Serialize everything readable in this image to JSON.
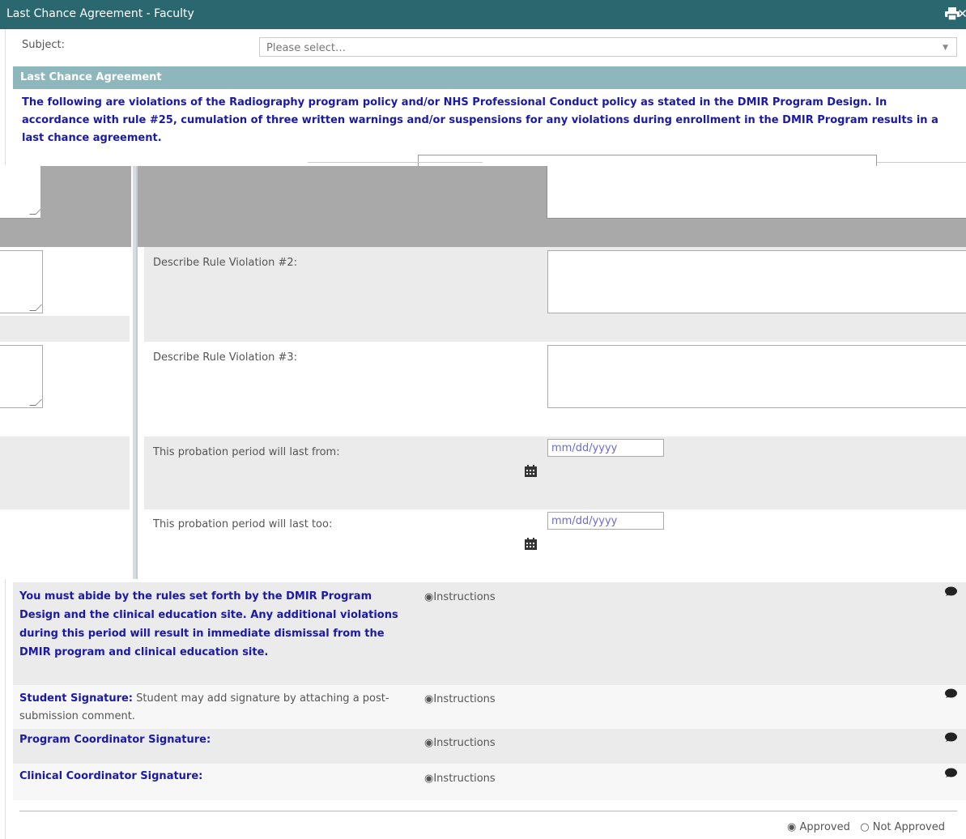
{
  "window": {
    "title": "Last Chance Agreement - Faculty"
  },
  "subject": {
    "label": "Subject:",
    "placeholder": "Please select…"
  },
  "section": {
    "heading": "Last Chance Agreement",
    "intro": "The following are violations of the Radiography program policy and/or NHS Professional Conduct policy as stated in the DMIR Program Design. In accordance with rule #25, cumulation of three written warnings and/or suspensions for any violations during enrollment in the DMIR Program results in a last chance agreement."
  },
  "violations": [
    {
      "label": "Describe Rule Violation #2:"
    },
    {
      "label": "Describe Rule Violation #3:"
    }
  ],
  "probation": {
    "from_label": "This probation period will last from:",
    "to_label": "This probation period will last too:",
    "date_placeholder": "mm/dd/yyyy"
  },
  "rules_notice": "You must abide by the rules set forth by the DMIR Program Design and the clinical education site. Any additional violations during this period will result in immediate dismissal from the DMIR program and clinical education site.",
  "signatures": {
    "student_label": "Student Signature:",
    "student_note": " Student may add signature by attaching a post-submission comment.",
    "program_label": "Program Coordinator Signature:",
    "clinical_label": "Clinical Coordinator Signature:"
  },
  "instructions_label": "Instructions",
  "approval": {
    "approved": "Approved",
    "not_approved": "Not Approved"
  },
  "icons": {
    "print": "print-icon",
    "close": "close-icon",
    "calendar": "calendar-icon",
    "comment": "comment-icon",
    "radio": "radio-icon"
  },
  "colors": {
    "titlebar": "#2a676f",
    "section_header": "#8db7bd",
    "emphasis_text": "#1a1aa6"
  }
}
